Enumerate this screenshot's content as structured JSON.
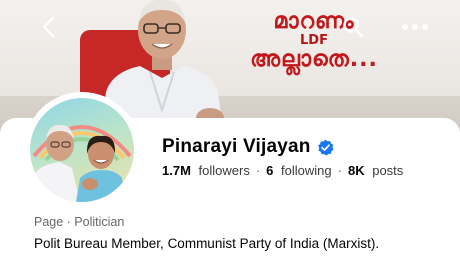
{
  "cover": {
    "text_lines": [
      "മാറണം",
      "LDF",
      "അല്ലാതെ..."
    ]
  },
  "header": {
    "back_icon": "chevron-left-icon",
    "search_icon": "search-icon",
    "more_icon": "more-horizontal-icon"
  },
  "profile": {
    "name": "Pinarayi Vijayan",
    "verified_icon": "verified-badge-icon",
    "verified_color": "#1877f2",
    "followers_count": "1.7M",
    "followers_label": "followers",
    "following_count": "6",
    "following_label": "following",
    "posts_count": "8K",
    "posts_label": "posts",
    "separator": "·",
    "category": "Page · Politician",
    "bio": "Polit Bureau Member, Communist Party of India (Marxist)."
  }
}
